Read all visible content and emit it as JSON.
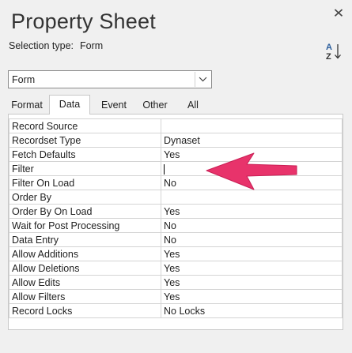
{
  "panel": {
    "title": "Property Sheet",
    "selection_type_label": "Selection type:",
    "selection_type_value": "Form",
    "close_glyph": "✕",
    "sort_icon": "sort-a-z-icon"
  },
  "object_dropdown": {
    "value": "Form",
    "arrow_icon": "chevron-down-icon"
  },
  "tabs": [
    {
      "label": "Format",
      "active": false
    },
    {
      "label": "Data",
      "active": true
    },
    {
      "label": "Event",
      "active": false
    },
    {
      "label": "Other",
      "active": false
    },
    {
      "label": "All",
      "active": false
    }
  ],
  "properties": [
    {
      "name": "Record Source",
      "value": ""
    },
    {
      "name": "Recordset Type",
      "value": "Dynaset"
    },
    {
      "name": "Fetch Defaults",
      "value": "Yes"
    },
    {
      "name": "Filter",
      "value": ""
    },
    {
      "name": "Filter On Load",
      "value": "No"
    },
    {
      "name": "Order By",
      "value": ""
    },
    {
      "name": "Order By On Load",
      "value": "Yes"
    },
    {
      "name": "Wait for Post Processing",
      "value": "No"
    },
    {
      "name": "Data Entry",
      "value": "No"
    },
    {
      "name": "Allow Additions",
      "value": "Yes"
    },
    {
      "name": "Allow Deletions",
      "value": "Yes"
    },
    {
      "name": "Allow Edits",
      "value": "Yes"
    },
    {
      "name": "Allow Filters",
      "value": "Yes"
    },
    {
      "name": "Record Locks",
      "value": "No Locks"
    }
  ],
  "annotation": {
    "arrow_color": "#e8336b",
    "points_to": "Filter"
  }
}
